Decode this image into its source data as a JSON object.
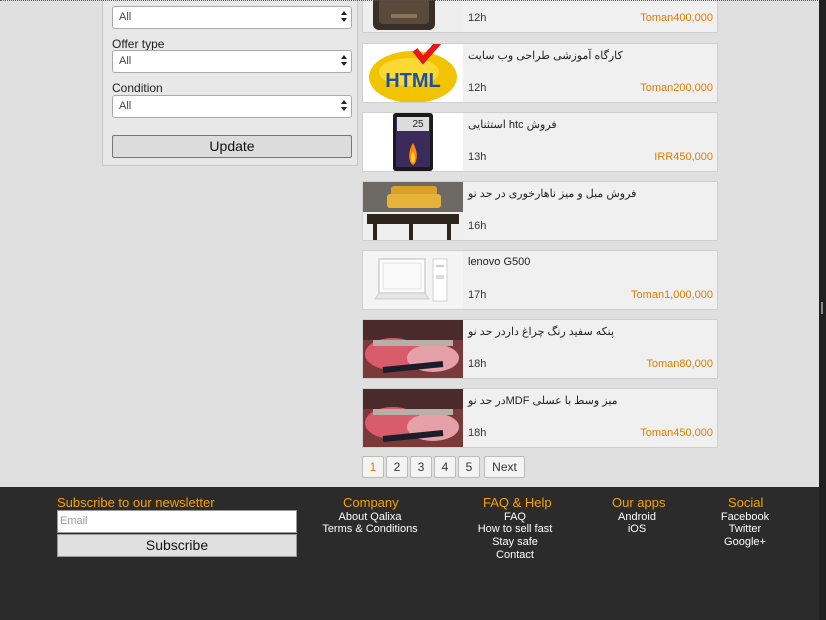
{
  "filters": {
    "first_value": "All",
    "offer_type_label": "Offer type",
    "offer_type_value": "All",
    "condition_label": "Condition",
    "condition_value": "All",
    "update_label": "Update"
  },
  "listings": [
    {
      "title": "",
      "age": "12h",
      "price": "Toman400,000"
    },
    {
      "title": "کارگاه آموزشی طراحی وب سایت",
      "age": "12h",
      "price": "Toman200,000"
    },
    {
      "title": "استثنایی htc فروش",
      "age": "13h",
      "price": "IRR450,000"
    },
    {
      "title": "فروش مبل و میز ناهارخوری در حد نو",
      "age": "16h",
      "price": ""
    },
    {
      "title": "lenovo G500",
      "age": "17h",
      "price": "Toman1,000,000"
    },
    {
      "title": "پنکه سفید رنگ چراغ داردر حد نو",
      "age": "18h",
      "price": "Toman80,000"
    },
    {
      "title": "در حد نوMDF میز وسط با عسلی",
      "age": "18h",
      "price": "Toman450,000"
    }
  ],
  "thumb_text": {
    "html": "HTML",
    "clock": "25"
  },
  "pagination": {
    "pages": [
      "1",
      "2",
      "3",
      "4",
      "5"
    ],
    "next": "Next",
    "active": "1"
  },
  "footer": {
    "newsletter_title": "Subscribe to our newsletter",
    "email_placeholder": "Email",
    "subscribe_label": "Subscribe",
    "company": {
      "title": "Company",
      "links": [
        "About Qalixa",
        "Terms & Conditions"
      ]
    },
    "faq": {
      "title": "FAQ & Help",
      "links": [
        "FAQ",
        "How to sell fast",
        "Stay safe",
        "Contact"
      ]
    },
    "apps": {
      "title": "Our apps",
      "links": [
        "Android",
        "iOS"
      ]
    },
    "social": {
      "title": "Social",
      "links": [
        "Facebook",
        "Twitter",
        "Google+"
      ]
    }
  },
  "colors": {
    "accent": "#e07b00",
    "footer_heading": "#f5a300",
    "footer_bg": "#2b2b2b"
  }
}
